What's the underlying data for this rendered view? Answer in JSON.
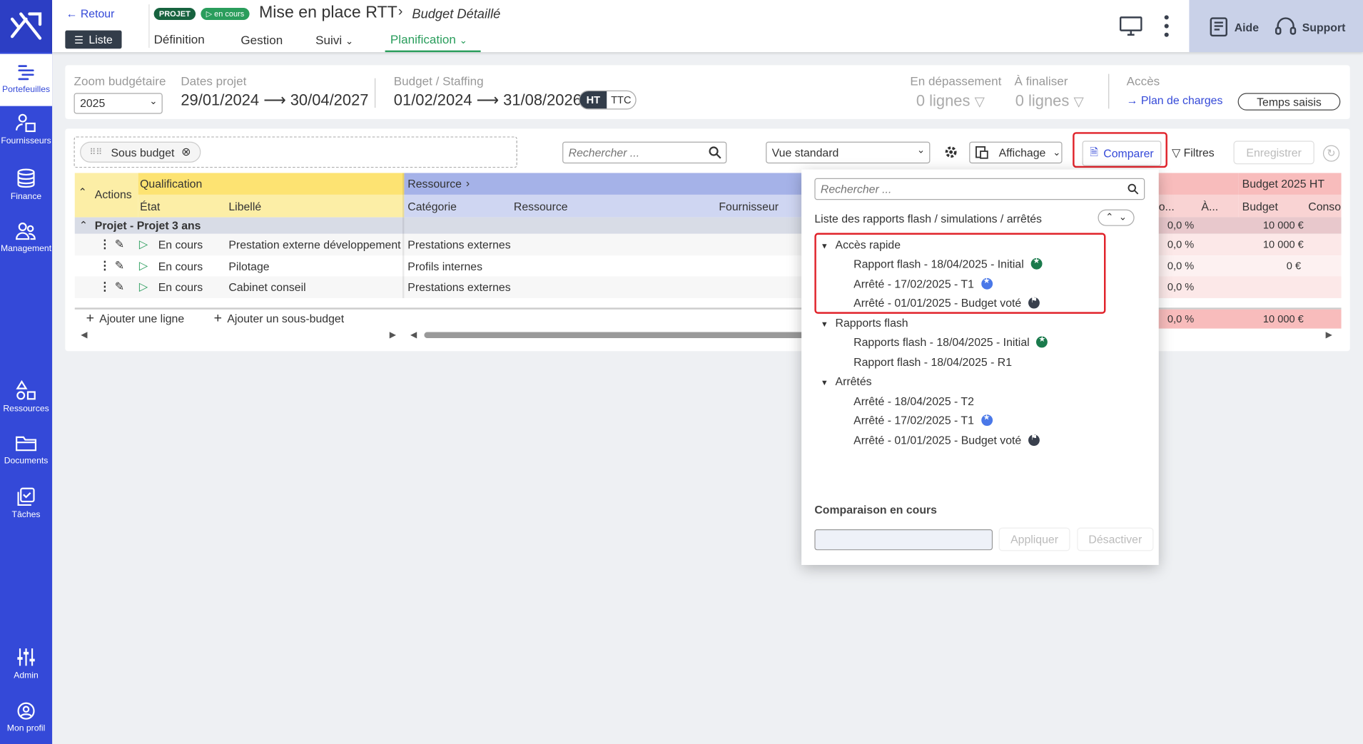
{
  "sidebar": {
    "items": [
      {
        "label": "Portefeuilles",
        "icon": "portfolio-icon"
      },
      {
        "label": "Fournisseurs",
        "icon": "suppliers-icon"
      },
      {
        "label": "Finance",
        "icon": "finance-icon"
      },
      {
        "label": "Management",
        "icon": "management-icon"
      },
      {
        "label": "Ressources",
        "icon": "resources-icon"
      },
      {
        "label": "Documents",
        "icon": "folder-icon"
      },
      {
        "label": "Tâches",
        "icon": "tasks-icon"
      },
      {
        "label": "Admin",
        "icon": "sliders-icon"
      },
      {
        "label": "Mon profil",
        "icon": "user-icon"
      }
    ]
  },
  "header": {
    "back": "Retour",
    "list": "Liste",
    "badge_projet": "PROJET",
    "badge_status": "en cours",
    "title": "Mise en place RTT",
    "subtitle": "Budget Détaillé",
    "tabs": [
      "Définition",
      "Gestion",
      "Suivi",
      "Planification"
    ],
    "help": "Aide",
    "support": "Support"
  },
  "info": {
    "zoom_label": "Zoom budgétaire",
    "zoom_value": "2025",
    "dates_label": "Dates projet",
    "dates_value": "29/01/2024 ⟶ 30/04/2027",
    "budget_label": "Budget / Staffing",
    "budget_value": "01/02/2024 ⟶ 31/08/2026",
    "ht": "HT",
    "ttc": "TTC",
    "overrun_label": "En dépassement",
    "overrun_value": "0 lignes",
    "finalize_label": "À finaliser",
    "finalize_value": "0 lignes",
    "access_label": "Accès",
    "access_link": "Plan de charges",
    "time_button": "Temps saisis"
  },
  "toolbar": {
    "chip": "Sous budget",
    "search_placeholder": "Rechercher ...",
    "view": "Vue standard",
    "display": "Affichage",
    "compare": "Comparer",
    "filters": "Filtres",
    "save": "Enregistrer"
  },
  "grid": {
    "actions": "Actions",
    "qualification": "Qualification",
    "etat": "État",
    "libelle": "Libellé",
    "ressource_group": "Ressource",
    "categorie": "Catégorie",
    "ressource": "Ressource",
    "fournisseur": "Fournisseur",
    "budget_group": "Budget 2025 HT",
    "col_o": "o...",
    "col_a": "À...",
    "col_budget": "Budget",
    "col_conso": "Conso",
    "group_row": "Projet - Projet 3 ans",
    "group_pct": "0,0 %",
    "group_budget": "10 000 €",
    "rows": [
      {
        "etat": "En cours",
        "libelle": "Prestation externe développement",
        "categorie": "Prestations externes",
        "pct": "0,0 %",
        "budget": "10 000 €"
      },
      {
        "etat": "En cours",
        "libelle": "Pilotage",
        "categorie": "Profils internes",
        "pct": "0,0 %",
        "budget": "0 €"
      },
      {
        "etat": "En cours",
        "libelle": "Cabinet conseil",
        "categorie": "Prestations externes",
        "pct": "0,0 %",
        "budget": ""
      }
    ],
    "total_pct": "0,0 %",
    "total_budget": "10 000 €",
    "add_line": "Ajouter une ligne",
    "add_sub": "Ajouter un sous-budget"
  },
  "dropdown": {
    "search_placeholder": "Rechercher ...",
    "list_title": "Liste des rapports flash / simulations / arrêtés",
    "g1": "Accès rapide",
    "g1_items": [
      "Rapport flash - 18/04/2025 - Initial",
      "Arrêté - 17/02/2025 - T1",
      "Arrêté - 01/01/2025 - Budget voté"
    ],
    "g2": "Rapports flash",
    "g2_items": [
      "Rapports flash - 18/04/2025 - Initial",
      "Rapport flash - 18/04/2025 - R1"
    ],
    "g3": "Arrêtés",
    "g3_items": [
      "Arrêté - 18/04/2025 - T2",
      "Arrêté - 17/02/2025 - T1",
      "Arrêté - 01/01/2025 - Budget voté"
    ],
    "current": "Comparaison en cours",
    "apply": "Appliquer",
    "deactivate": "Désactiver"
  },
  "colors": {
    "sidebar": "#3449d8",
    "accent": "#2a9d5c",
    "highlight": "#e0222a"
  }
}
